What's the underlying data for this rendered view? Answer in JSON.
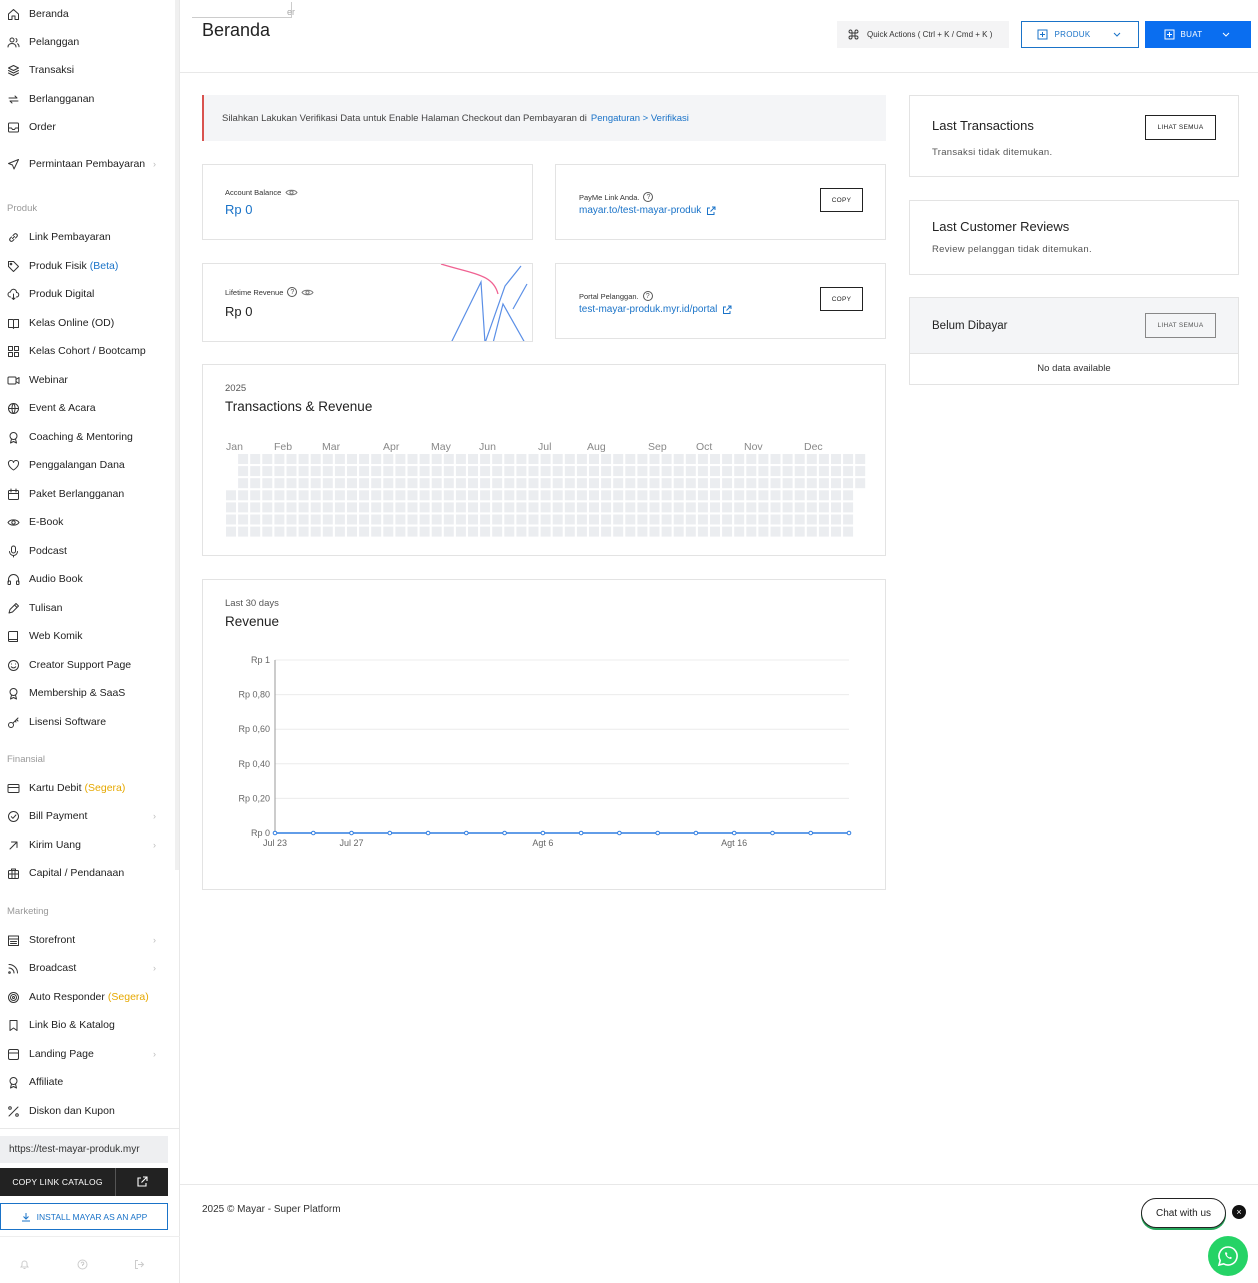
{
  "sidebar": {
    "items_top": [
      {
        "label": "Beranda",
        "icon": "home-icon"
      },
      {
        "label": "Pelanggan",
        "icon": "users-icon"
      },
      {
        "label": "Transaksi",
        "icon": "layers-icon"
      },
      {
        "label": "Berlangganan",
        "icon": "repeat-icon"
      },
      {
        "label": "Order",
        "icon": "inbox-icon"
      },
      {
        "label": "Permintaan Pembayaran",
        "icon": "send-icon"
      }
    ],
    "section_produk": "Produk",
    "items_produk": [
      {
        "label": "Link Pembayaran",
        "icon": "link-icon"
      },
      {
        "label": "Produk Fisik",
        "badge": "(Beta)",
        "icon": "tag-icon"
      },
      {
        "label": "Produk Digital",
        "icon": "cloud-download-icon"
      },
      {
        "label": "Kelas Online (OD)",
        "icon": "book-open-icon"
      },
      {
        "label": "Kelas Cohort / Bootcamp",
        "icon": "grid-icon"
      },
      {
        "label": "Webinar",
        "icon": "video-icon"
      },
      {
        "label": "Event & Acara",
        "icon": "globe-icon"
      },
      {
        "label": "Coaching & Mentoring",
        "icon": "award-icon"
      },
      {
        "label": "Penggalangan Dana",
        "icon": "heart-icon"
      },
      {
        "label": "Paket Berlangganan",
        "icon": "calendar-icon"
      },
      {
        "label": "E-Book",
        "icon": "eye-icon"
      },
      {
        "label": "Podcast",
        "icon": "mic-icon"
      },
      {
        "label": "Audio Book",
        "icon": "headphones-icon"
      },
      {
        "label": "Tulisan",
        "icon": "pen-icon"
      },
      {
        "label": "Web Komik",
        "icon": "book-icon"
      },
      {
        "label": "Creator Support Page",
        "icon": "smile-icon"
      },
      {
        "label": "Membership & SaaS",
        "icon": "medal-icon"
      },
      {
        "label": "Lisensi Software",
        "icon": "key-icon"
      }
    ],
    "section_finansial": "Finansial",
    "items_finansial": [
      {
        "label": "Kartu Debit",
        "badge": "(Segera)",
        "icon": "credit-card-icon"
      },
      {
        "label": "Bill Payment",
        "icon": "check-circle-icon"
      },
      {
        "label": "Kirim Uang",
        "icon": "arrow-up-right-icon"
      },
      {
        "label": "Capital / Pendanaan",
        "icon": "briefcase-icon"
      }
    ],
    "section_marketing": "Marketing",
    "items_marketing": [
      {
        "label": "Storefront",
        "icon": "storefront-icon"
      },
      {
        "label": "Broadcast",
        "icon": "rss-icon"
      },
      {
        "label": "Auto Responder",
        "badge": "(Segera)",
        "icon": "target-icon"
      },
      {
        "label": "Link Bio & Katalog",
        "icon": "bookmark-icon"
      },
      {
        "label": "Landing Page",
        "icon": "layout-icon"
      },
      {
        "label": "Affiliate",
        "icon": "award-icon"
      },
      {
        "label": "Diskon dan Kupon",
        "icon": "percent-icon"
      }
    ],
    "catalog_url": "https://test-mayar-produk.myr",
    "copy_link_catalog": "COPY LINK CATALOG",
    "install_app": "INSTALL MAYAR AS AN APP"
  },
  "header": {
    "breadcrumb": "er",
    "title": "Beranda",
    "quick_actions": "Quick Actions ( Ctrl + K / Cmd + K )",
    "produk_btn": "PRODUK",
    "buat_btn": "BUAT"
  },
  "alert": {
    "text": "Silahkan Lakukan Verifikasi Data untuk Enable Halaman Checkout dan Pembayaran di",
    "link": "Pengaturan > Verifikasi",
    "accent_color": "#d9534f"
  },
  "balance": {
    "label": "Account Balance",
    "value": "Rp 0"
  },
  "payme": {
    "label": "PayMe Link Anda.",
    "link": "mayar.to/test-mayar-produk",
    "copy": "COPY"
  },
  "lifetime": {
    "label": "Lifetime Revenue",
    "value": "Rp 0"
  },
  "portal": {
    "label": "Portal Pelanggan.",
    "link": "test-mayar-produk.myr.id/portal",
    "copy": "COPY"
  },
  "heatmap": {
    "year": "2025",
    "title": "Transactions & Revenue",
    "months": [
      "Jan",
      "Feb",
      "Mar",
      "Apr",
      "May",
      "Jun",
      "Jul",
      "Aug",
      "Sep",
      "Oct",
      "Nov",
      "Dec"
    ]
  },
  "revenue_chart": {
    "subtitle": "Last 30 days",
    "title": "Revenue"
  },
  "chart_data": {
    "type": "line",
    "title": "Revenue",
    "subtitle": "Last 30 days",
    "y_ticks": [
      "Rp 1",
      "Rp 0,80",
      "Rp 0,60",
      "Rp 0,40",
      "Rp 0,20",
      "Rp 0"
    ],
    "ylim": [
      0,
      1
    ],
    "x_ticks": [
      "Jul 23",
      "Jul 27",
      "Agt 6",
      "Agt 16"
    ],
    "series": [
      {
        "values": [
          0,
          0,
          0,
          0,
          0,
          0,
          0,
          0,
          0,
          0,
          0,
          0,
          0,
          0,
          0,
          0,
          0,
          0,
          0,
          0,
          0,
          0,
          0,
          0,
          0,
          0,
          0,
          0,
          0,
          0,
          0
        ],
        "color": "#2f7de1"
      }
    ],
    "grid": true
  },
  "last_transactions": {
    "title": "Last Transactions",
    "empty": "Transaksi tidak ditemukan.",
    "see_all": "LIHAT SEMUA"
  },
  "last_reviews": {
    "title": "Last Customer Reviews",
    "empty": "Review pelanggan tidak ditemukan."
  },
  "unpaid": {
    "title": "Belum Dibayar",
    "see_all": "LIHAT SEMUA",
    "empty": "No data available"
  },
  "footer": {
    "text": "2025 © Mayar - Super Platform"
  },
  "chat": {
    "label": "Chat with us",
    "close": "×"
  }
}
